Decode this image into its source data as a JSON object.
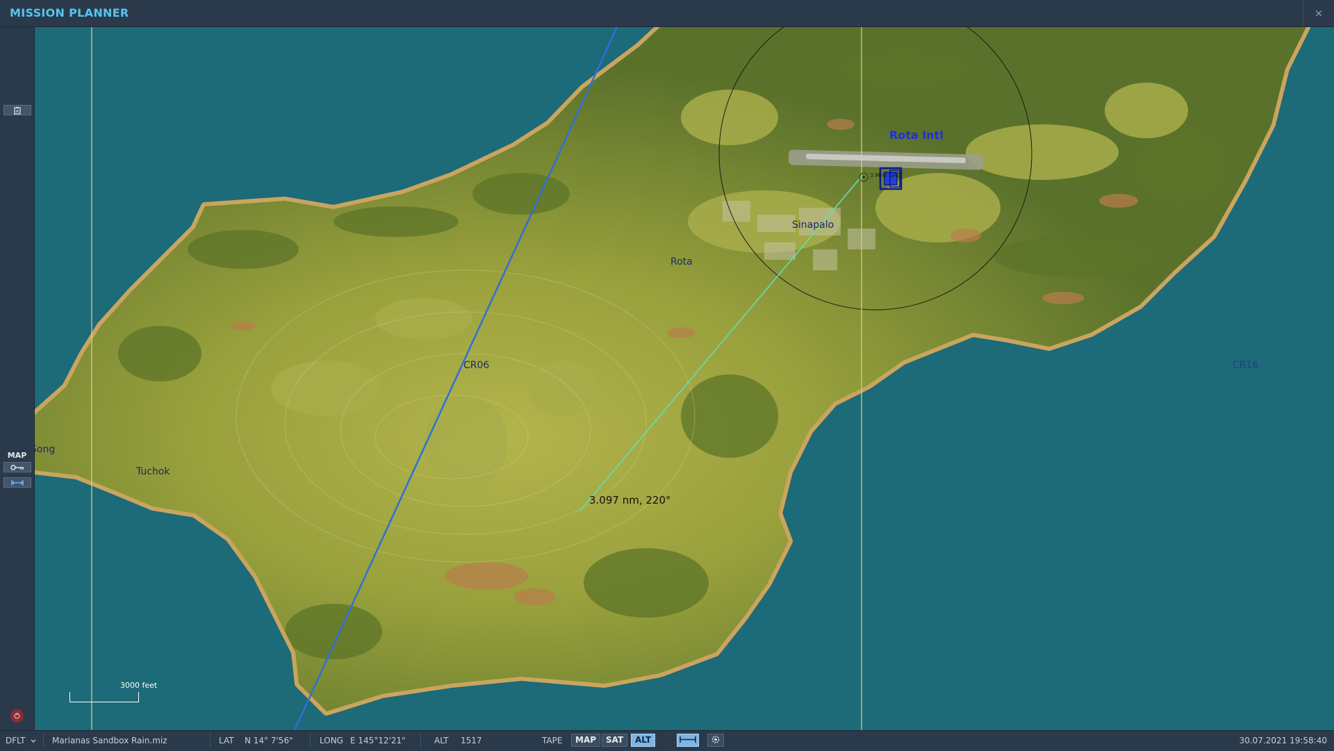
{
  "window": {
    "title": "MISSION PLANNER",
    "close_glyph": "×"
  },
  "sidebar": {
    "map_label": "MAP",
    "icons": [
      "clipboard-icon",
      "key-icon",
      "ruler-icon",
      "exit-icon"
    ]
  },
  "map": {
    "airfield_label": "Rota Intl",
    "navaid_label": "3 MHz GRO",
    "places": {
      "sinapalo": "Sinapalo",
      "rota": "Rota",
      "cr06": "CR06",
      "cr16": "CR16",
      "song": "Song",
      "tuchok": "Tuchok"
    },
    "measure_label": "3.097 nm, 220°",
    "scale_label": "3000 feet",
    "colors": {
      "sea": "#1d6a78",
      "land_dark": "#566d2a",
      "land_light": "#b1b14a",
      "flight_path": "#2f6fd8",
      "measure_line": "#5fe0b8",
      "gridline": "#d8d48a"
    }
  },
  "statusbar": {
    "profile": "DFLT",
    "mission_file": "Marianas Sandbox Rain.miz",
    "lat_label": "LAT",
    "lat_value": "N 14° 7'56\"",
    "long_label": "LONG",
    "long_value": "E 145°12'21\"",
    "alt_label": "ALT",
    "alt_value": "1517",
    "tape_label": "TAPE",
    "map_btn": "MAP",
    "sat_btn": "SAT",
    "alt_btn": "ALT",
    "datetime": "30.07.2021 19:58:40"
  }
}
